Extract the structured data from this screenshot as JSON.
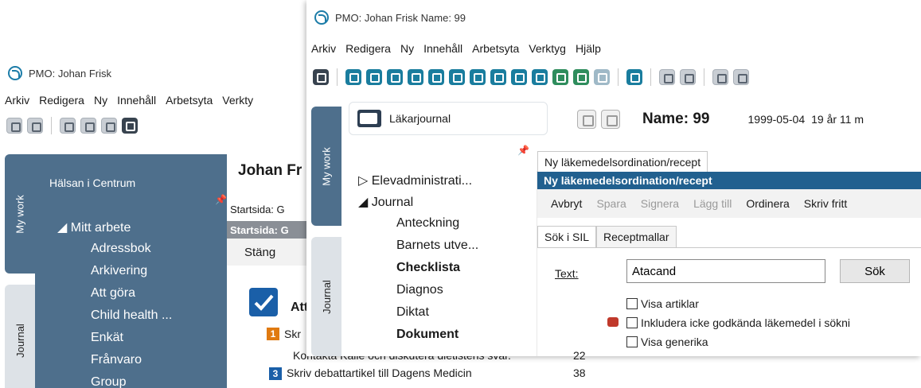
{
  "back_window": {
    "title": "PMO: Johan Frisk",
    "menu": [
      "Arkiv",
      "Redigera",
      "Ny",
      "Innehåll",
      "Arbetsyta",
      "Verkty"
    ],
    "vtabs": [
      "My work",
      "Journal"
    ],
    "org_name": "Hälsan i Centrum",
    "patient_partial": "Johan Fr",
    "tree": [
      {
        "label": "◢ Mitt arbete",
        "indent": 0
      },
      {
        "label": "Adressbok",
        "indent": 1
      },
      {
        "label": "Arkivering",
        "indent": 1
      },
      {
        "label": "Att göra",
        "indent": 1
      },
      {
        "label": "Child health ...",
        "indent": 1
      },
      {
        "label": "Enkät",
        "indent": 1
      },
      {
        "label": "Frånvaro",
        "indent": 1
      },
      {
        "label": "Group",
        "indent": 1
      }
    ],
    "start_tab": "Startsida: G",
    "start_header": "Startsida: G",
    "close_label": "Stäng",
    "todo_title": "Att",
    "todo_items": [
      {
        "badge": "1",
        "text": "Skr",
        "count": ""
      },
      {
        "badge": "",
        "text": "Kontakta Kalle och diskutera dietistens svar.",
        "count": "22"
      },
      {
        "badge": "3",
        "text": "Skriv debattartikel till Dagens Medicin",
        "count": "38"
      }
    ]
  },
  "front_window": {
    "title": "PMO: Johan Frisk  Name: 99",
    "menu": [
      "Arkiv",
      "Redigera",
      "Ny",
      "Innehåll",
      "Arbetsyta",
      "Verktyg",
      "Hjälp"
    ],
    "vtabs": [
      "My work",
      "Journal"
    ],
    "journal_box": "Läkarjournal",
    "tree": [
      {
        "label": "▷ Elevadministrati...",
        "bold": false,
        "indent": 0
      },
      {
        "label": "◢ Journal",
        "bold": false,
        "indent": 0
      },
      {
        "label": "Anteckning",
        "bold": false,
        "indent": 1
      },
      {
        "label": "Barnets utve...",
        "bold": false,
        "indent": 1
      },
      {
        "label": "Checklista",
        "bold": true,
        "indent": 1
      },
      {
        "label": "Diagnos",
        "bold": false,
        "indent": 1
      },
      {
        "label": "Diktat",
        "bold": false,
        "indent": 1
      },
      {
        "label": "Dokument",
        "bold": true,
        "indent": 1
      }
    ],
    "patient": {
      "name": "Name: 99",
      "birth": "1999-05-04",
      "age": "19 år 11 m"
    },
    "doc_tab": "Ny läkemedelsordination/recept",
    "doc_header": "Ny läkemedelsordination/recept",
    "actions": [
      {
        "label": "Avbryt",
        "enabled": true
      },
      {
        "label": "Spara",
        "enabled": false
      },
      {
        "label": "Signera",
        "enabled": false
      },
      {
        "label": "Lägg till",
        "enabled": false
      },
      {
        "label": "Ordinera",
        "enabled": true
      },
      {
        "label": "Skriv fritt",
        "enabled": true
      }
    ],
    "subtabs": [
      "Sök i SIL",
      "Receptmallar"
    ],
    "form": {
      "text_label": "Text:",
      "text_value": "Atacand",
      "search_button": "Sök",
      "checkboxes": [
        "Visa artiklar",
        "Inkludera icke godkända läkemedel i sökni",
        "Visa generika"
      ]
    }
  },
  "colors": {
    "nav_blue": "#4e6f8c",
    "header_blue": "#21608f",
    "logo_blue": "#1c7ca8"
  }
}
